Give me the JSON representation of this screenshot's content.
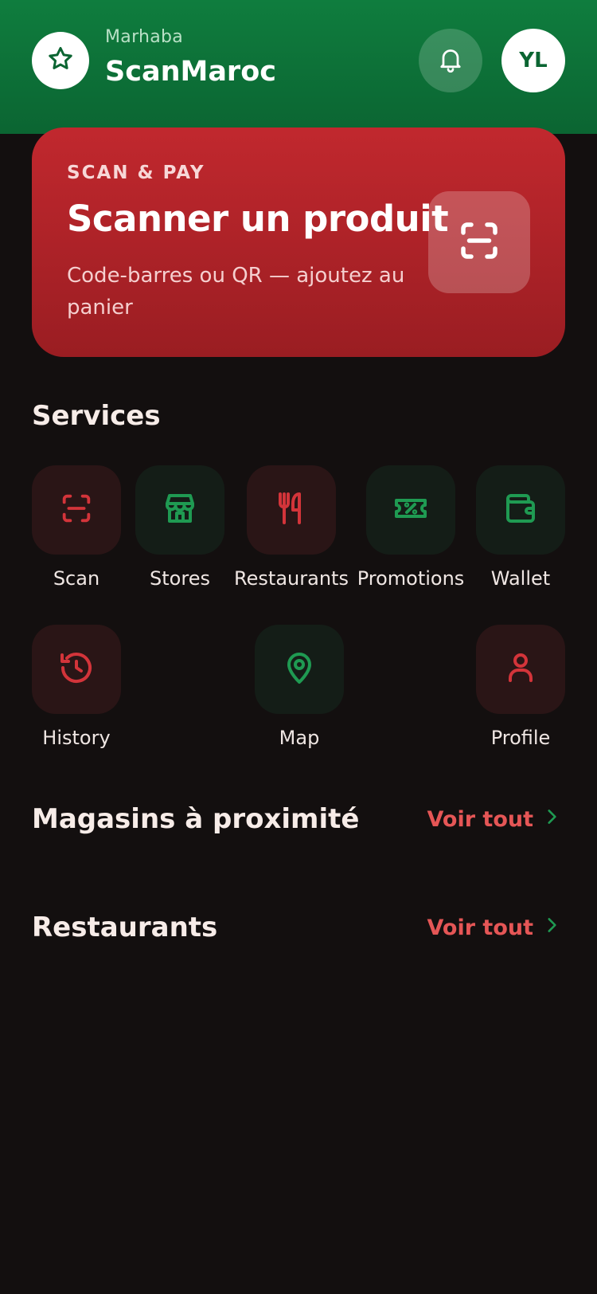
{
  "header": {
    "greeting": "Marhaba",
    "app_name": "ScanMaroc",
    "avatar_initials": "YL",
    "logo_icon": "star-icon",
    "notification_icon": "bell-icon"
  },
  "scan_card": {
    "eyebrow": "SCAN & PAY",
    "title": "Scanner un produit",
    "subtitle": "Code-barres ou QR — ajoutez au panier",
    "icon": "scan-icon"
  },
  "services": {
    "title": "Services",
    "items": [
      {
        "label": "Scan",
        "icon": "scan-icon",
        "tone": "red"
      },
      {
        "label": "Stores",
        "icon": "store-icon",
        "tone": "green"
      },
      {
        "label": "Restaurants",
        "icon": "utensils-icon",
        "tone": "red"
      },
      {
        "label": "Promotions",
        "icon": "ticket-percent-icon",
        "tone": "green"
      },
      {
        "label": "Wallet",
        "icon": "wallet-icon",
        "tone": "green"
      },
      {
        "label": "History",
        "icon": "history-icon",
        "tone": "red"
      },
      {
        "label": "Map",
        "icon": "map-pin-icon",
        "tone": "green"
      },
      {
        "label": "Profile",
        "icon": "user-icon",
        "tone": "red"
      }
    ]
  },
  "nearby_stores": {
    "title": "Magasins à proximité",
    "see_all": "Voir tout"
  },
  "restaurants": {
    "title": "Restaurants",
    "see_all": "Voir tout"
  },
  "colors": {
    "header_green": "#0f7d3e",
    "card_red": "#c1282e",
    "accent_red": "#e55656",
    "icon_red": "#d3343a",
    "icon_green": "#1f9a52",
    "background": "#130f0f"
  }
}
